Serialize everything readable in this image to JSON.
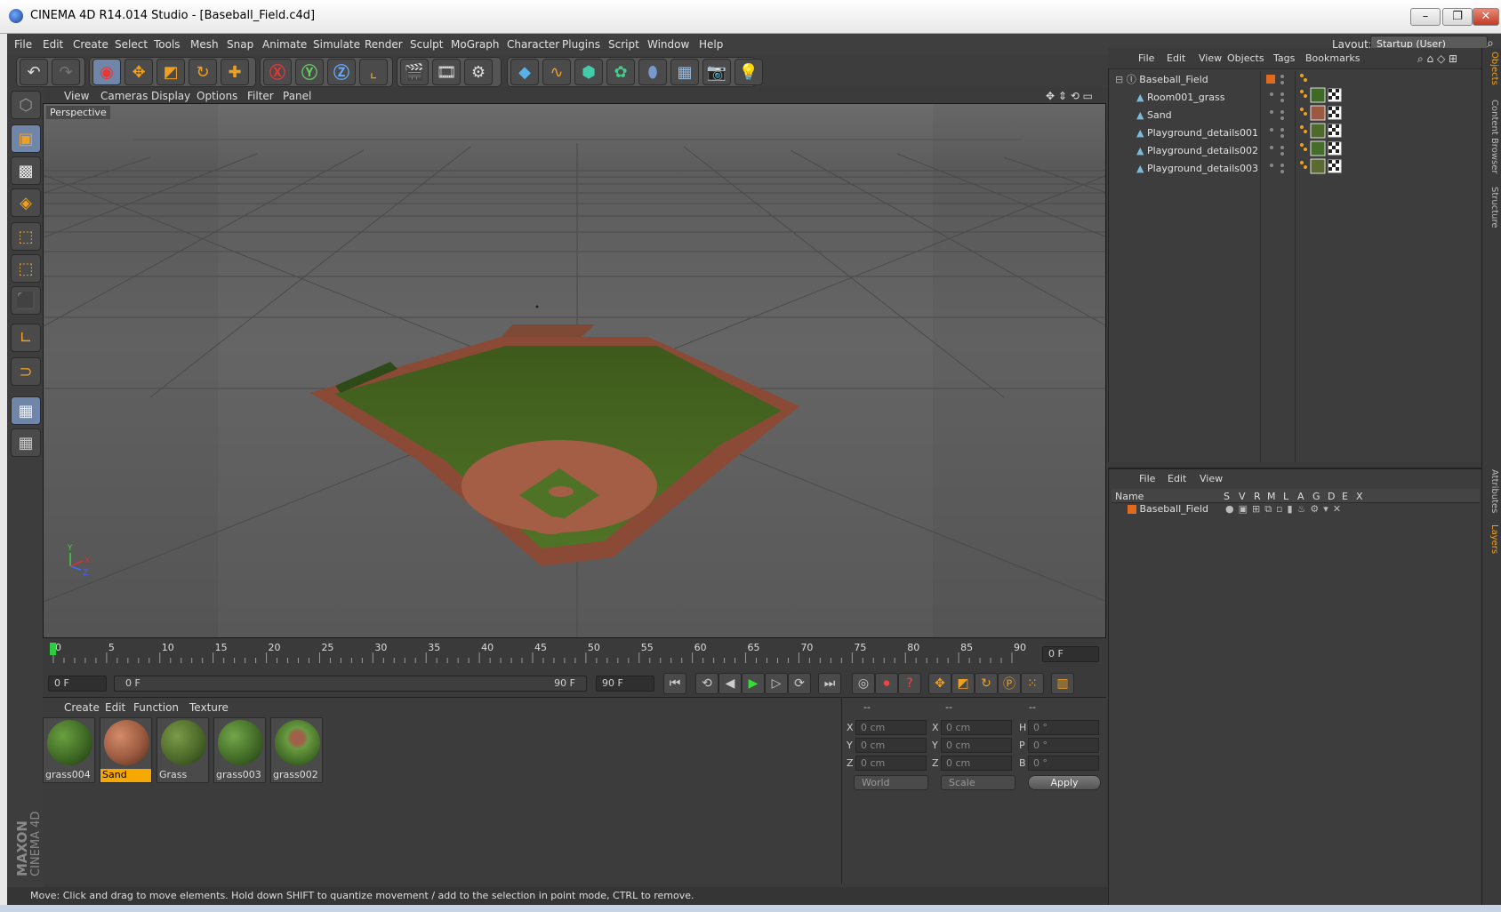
{
  "window": {
    "title": "CINEMA 4D R14.014 Studio - [Baseball_Field.c4d]",
    "min": "–",
    "max": "❐",
    "close": "✕"
  },
  "menubar": {
    "items": [
      "File",
      "Edit",
      "Create",
      "Select",
      "Tools",
      "Mesh",
      "Snap",
      "Animate",
      "Simulate",
      "Render",
      "Sculpt",
      "MoGraph",
      "Character",
      "Plugins",
      "Script",
      "Window",
      "Help"
    ],
    "layout_label": "Layout:",
    "layout_value": "Startup (User)"
  },
  "viewport": {
    "menu": [
      "View",
      "Cameras",
      "Display",
      "Options",
      "Filter",
      "Panel"
    ],
    "camera_label": "Perspective",
    "axis": {
      "y": "Y",
      "x": "X",
      "z": "Z"
    }
  },
  "timeline": {
    "ticks": [
      "0",
      "5",
      "10",
      "15",
      "20",
      "25",
      "30",
      "35",
      "40",
      "45",
      "50",
      "55",
      "60",
      "65",
      "70",
      "75",
      "80",
      "85",
      "90"
    ],
    "current_frame": "0 F"
  },
  "transport": {
    "start": "0 F",
    "range_start": "0 F",
    "range_end": "90 F",
    "end": "90 F"
  },
  "material_manager": {
    "menu": [
      "Create",
      "Edit",
      "Function",
      "Texture"
    ],
    "materials": [
      {
        "name": "grass004",
        "color": "#3f6a25",
        "selected": false
      },
      {
        "name": "Sand",
        "color": "#9b5a40",
        "selected": true
      },
      {
        "name": "Grass",
        "color": "#4d6a2a",
        "selected": false
      },
      {
        "name": "grass003",
        "color": "#436d28",
        "selected": false
      },
      {
        "name": "grass002",
        "color": "#5a7a3a",
        "selected": false
      }
    ]
  },
  "coordinates": {
    "headers": [
      "--",
      "--",
      "--"
    ],
    "rows": [
      {
        "a": "X",
        "av": "0 cm",
        "b": "X",
        "bv": "0 cm",
        "c": "H",
        "cv": "0 °"
      },
      {
        "a": "Y",
        "av": "0 cm",
        "b": "Y",
        "bv": "0 cm",
        "c": "P",
        "cv": "0 °"
      },
      {
        "a": "Z",
        "av": "0 cm",
        "b": "Z",
        "bv": "0 cm",
        "c": "B",
        "cv": "0 °"
      }
    ],
    "space": "World",
    "mode": "Scale",
    "apply": "Apply"
  },
  "status": "Move: Click and drag to move elements. Hold down SHIFT to quantize movement / add to the selection in point mode, CTRL to remove.",
  "objects_panel": {
    "menu": [
      "File",
      "Edit",
      "View",
      "Objects",
      "Tags",
      "Bookmarks"
    ],
    "items": [
      {
        "name": "Baseball_Field",
        "level": 0
      },
      {
        "name": "Room001_grass",
        "level": 1
      },
      {
        "name": "Sand",
        "level": 1
      },
      {
        "name": "Playground_details001",
        "level": 1
      },
      {
        "name": "Playground_details002",
        "level": 1
      },
      {
        "name": "Playground_details003",
        "level": 1
      }
    ]
  },
  "layers_panel": {
    "menu": [
      "File",
      "Edit",
      "View"
    ],
    "columns": [
      "Name",
      "S",
      "V",
      "R",
      "M",
      "L",
      "A",
      "G",
      "D",
      "E",
      "X"
    ],
    "rows": [
      {
        "name": "Baseball_Field"
      }
    ]
  },
  "side_tabs": [
    "Objects",
    "Content Browser",
    "Structure",
    "Attributes",
    "Layers"
  ],
  "brand": {
    "line1": "MAXON",
    "line2": "CINEMA 4D"
  }
}
